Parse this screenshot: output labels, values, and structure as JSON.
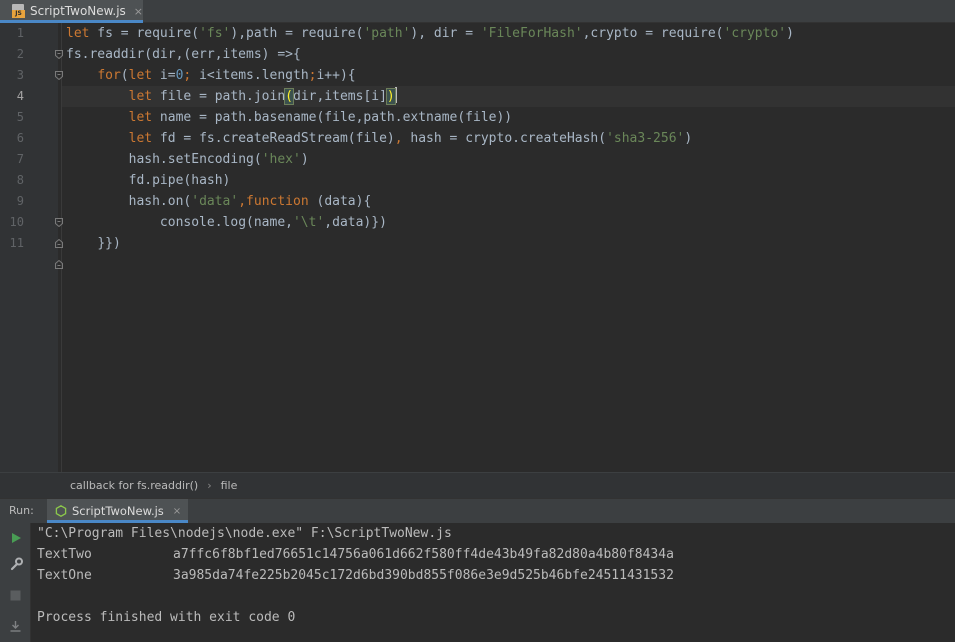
{
  "editor_tab": {
    "label": "ScriptTwoNew.js",
    "close": "×",
    "icon_badge": "JS"
  },
  "editor": {
    "line_numbers": [
      "1",
      "2",
      "3",
      "4",
      "5",
      "6",
      "7",
      "8",
      "9",
      "10",
      "11"
    ],
    "current_line": "4",
    "code": {
      "l1": {
        "let": "let",
        "a": " fs = require(",
        "s1": "'fs'",
        "b": "),path = require(",
        "s2": "'path'",
        "c": "), dir = ",
        "s3": "'FileForHash'",
        "d": ",crypto = require(",
        "s4": "'crypto'",
        "e": ")"
      },
      "l2": {
        "a": "fs.readdir(dir,(err,items) =>{"
      },
      "l3": {
        "indent": "    ",
        "for": "for",
        "a": "(",
        "let": "let",
        "b": " i=",
        "zero": "0",
        "semi": ";",
        "c": " i<items.length",
        "semi2": ";",
        "d": "i++){"
      },
      "l4": {
        "indent": "        ",
        "let": "let",
        "a": " file = path.join",
        "open": "(",
        "b": "dir,items[i]",
        "close": ")"
      },
      "l5": {
        "indent": "        ",
        "let": "let",
        "a": " name = path.basename(file,path.extname(file))"
      },
      "l6": {
        "indent": "        ",
        "let": "let",
        "a": " fd = fs.createReadStream(file)",
        "comma": ",",
        "b": " hash = crypto.createHash(",
        "s": "'sha3-256'",
        "c": ")"
      },
      "l7": {
        "indent": "        ",
        "a": "hash.setEncoding(",
        "s": "'hex'",
        "b": ")"
      },
      "l8": {
        "indent": "        ",
        "a": "fd.pipe(hash)"
      },
      "l9": {
        "indent": "        ",
        "a": "hash.on(",
        "s": "'data'",
        "comma": ",",
        "fn": "function",
        "b": " (data){"
      },
      "l10": {
        "indent": "            ",
        "a": "console.log(name,",
        "s": "'\\t'",
        "b": ",data)})"
      },
      "l11": {
        "indent": "    ",
        "a": "}})"
      }
    }
  },
  "breadcrumb": {
    "items": [
      "callback for fs.readdir()",
      "file"
    ],
    "separator": "›"
  },
  "run_panel": {
    "title": "Run:",
    "tab_label": "ScriptTwoNew.js",
    "tab_close": "×",
    "console": {
      "command": "\"C:\\Program Files\\nodejs\\node.exe\" F:\\ScriptTwoNew.js",
      "rows": [
        {
          "name": "TextTwo",
          "hash": "a7ffc6f8bf1ed76651c14756a061d662f580ff4de43b49fa82d80a4b80f8434a"
        },
        {
          "name": "TextOne",
          "hash": "3a985da74fe225b2045c172d6bd390bd855f086e3e9d525b46bfe24511431532"
        }
      ],
      "exit_message": "Process finished with exit code 0"
    }
  },
  "colors": {
    "keyword": "#cc7832",
    "string": "#6a8759",
    "text": "#a9b7c6",
    "accent": "#4a88c7"
  }
}
